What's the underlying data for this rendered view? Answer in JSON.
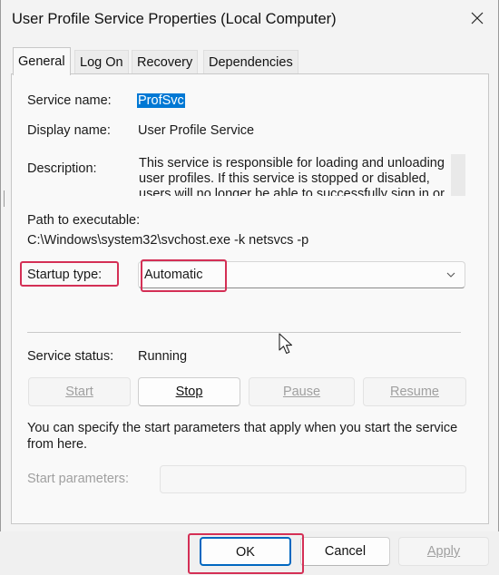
{
  "window": {
    "title": "User Profile Service Properties (Local Computer)",
    "close_icon": "close-icon"
  },
  "tabs": [
    {
      "label": "General",
      "active": true
    },
    {
      "label": "Log On",
      "active": false
    },
    {
      "label": "Recovery",
      "active": false
    },
    {
      "label": "Dependencies",
      "active": false
    }
  ],
  "general": {
    "service_name_label": "Service name:",
    "service_name_value": "ProfSvc",
    "display_name_label": "Display name:",
    "display_name_value": "User Profile Service",
    "description_label": "Description:",
    "description_value": "This service is responsible for loading and unloading user profiles. If this service is stopped or disabled, users will no longer be able to successfully sign in or",
    "path_label": "Path to executable:",
    "path_value": "C:\\Windows\\system32\\svchost.exe -k netsvcs -p",
    "startup_type_label": "Startup type:",
    "startup_type_value": "Automatic",
    "service_status_label": "Service status:",
    "service_status_value": "Running",
    "start_label": "Start",
    "stop_label": "Stop",
    "pause_label": "Pause",
    "resume_label": "Resume",
    "start_params_text": "You can specify the start parameters that apply when you start the service from here.",
    "start_params_label": "Start parameters:",
    "start_params_value": ""
  },
  "footer": {
    "ok_label": "OK",
    "cancel_label": "Cancel",
    "apply_label": "Apply"
  },
  "colors": {
    "highlight_box": "#d42f55",
    "selection": "#0078d4"
  }
}
